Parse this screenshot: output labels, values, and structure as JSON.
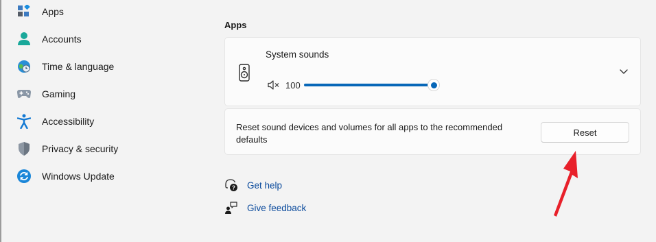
{
  "sidebar": {
    "items": [
      {
        "label": "Apps",
        "icon": "apps-icon"
      },
      {
        "label": "Accounts",
        "icon": "accounts-icon"
      },
      {
        "label": "Time & language",
        "icon": "time-language-icon"
      },
      {
        "label": "Gaming",
        "icon": "gaming-icon"
      },
      {
        "label": "Accessibility",
        "icon": "accessibility-icon"
      },
      {
        "label": "Privacy & security",
        "icon": "shield-icon"
      },
      {
        "label": "Windows Update",
        "icon": "windows-update-icon"
      }
    ]
  },
  "main": {
    "section_title": "Apps",
    "system_sounds": {
      "title": "System sounds",
      "volume": "100",
      "volume_level": 1.0,
      "expanded": false
    },
    "reset": {
      "description": "Reset sound devices and volumes for all apps to the recommended defaults",
      "button_label": "Reset"
    },
    "links": [
      {
        "label": "Get help",
        "icon": "get-help-icon"
      },
      {
        "label": "Give feedback",
        "icon": "feedback-icon"
      }
    ]
  },
  "colors": {
    "accent": "#0767b8",
    "link": "#0a4a9c",
    "background": "#f3f3f3",
    "annotation_arrow": "#e8202a"
  }
}
